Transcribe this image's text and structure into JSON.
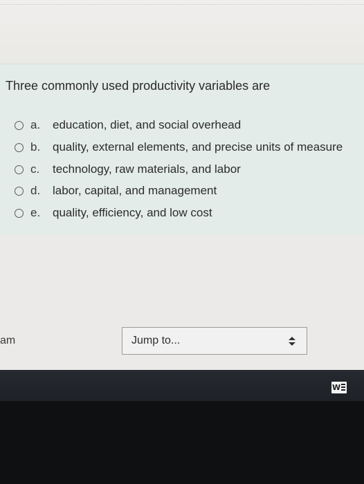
{
  "question": {
    "prompt": "Three commonly used productivity variables are",
    "options": [
      {
        "letter": "a.",
        "text": "education, diet, and social overhead"
      },
      {
        "letter": "b.",
        "text": "quality, external elements, and precise units of measure"
      },
      {
        "letter": "c.",
        "text": "technology, raw materials, and labor"
      },
      {
        "letter": "d.",
        "text": "labor, capital, and management"
      },
      {
        "letter": "e.",
        "text": "quality, efficiency, and low cost"
      }
    ]
  },
  "navigation": {
    "side_text": "am",
    "jump_placeholder": "Jump to..."
  },
  "taskbar": {
    "word_icon_letter": "W"
  },
  "colors": {
    "question_panel": "#e3ece8",
    "taskbar": "#262a30"
  }
}
